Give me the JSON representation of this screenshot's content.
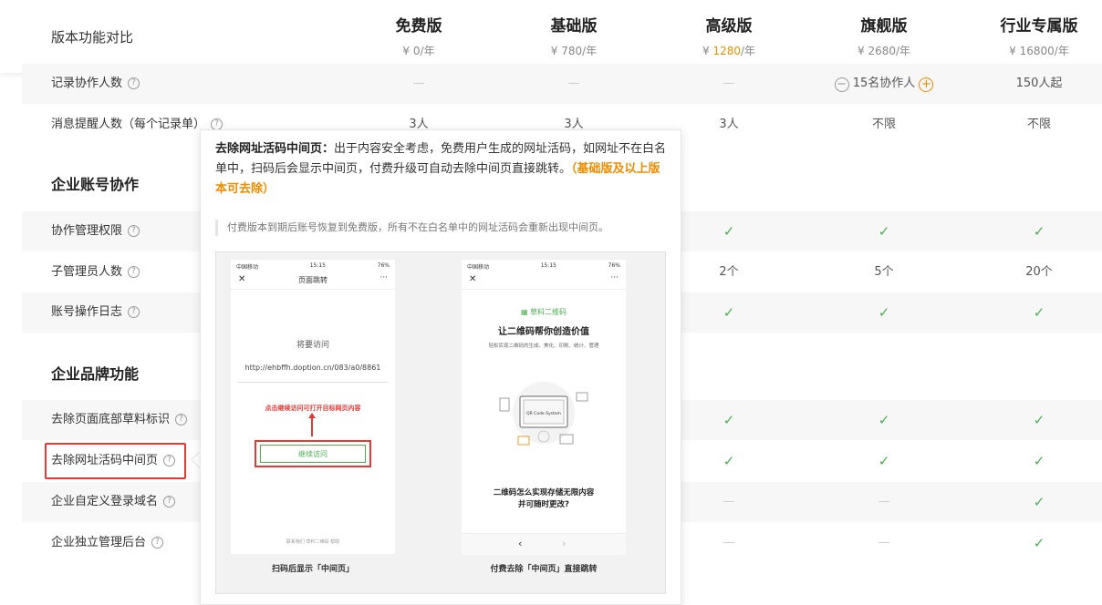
{
  "header": {
    "title": "版本功能对比",
    "currency": "¥",
    "per": "/年",
    "plans": [
      {
        "name": "免费版",
        "price": "0"
      },
      {
        "name": "基础版",
        "price": "780"
      },
      {
        "name": "高级版",
        "price": "1280"
      },
      {
        "name": "旗舰版",
        "price": "2680"
      },
      {
        "name": "行业专属版",
        "price": "16800"
      }
    ],
    "accent_color": "#f08c00"
  },
  "rows": {
    "collaborators": {
      "label": "记录协作人数",
      "cells": [
        "—",
        "—",
        "—",
        "15名协作人",
        "150人起"
      ]
    },
    "reminders": {
      "label": "消息提醒人数（每个记录单）",
      "cells": [
        "3人",
        "3人",
        "3人",
        "不限",
        "不限"
      ]
    }
  },
  "sections": {
    "account": {
      "title": "企业账号协作",
      "rows": [
        {
          "label": "协作管理权限",
          "cells": [
            "",
            "",
            "✓",
            "✓",
            "✓"
          ]
        },
        {
          "label": "子管理员人数",
          "cells": [
            "",
            "",
            "2个",
            "5个",
            "20个"
          ]
        },
        {
          "label": "账号操作日志",
          "cells": [
            "",
            "",
            "✓",
            "✓",
            "✓"
          ]
        }
      ]
    },
    "brand": {
      "title": "企业品牌功能",
      "rows": [
        {
          "label": "去除页面底部草料标识",
          "cells": [
            "",
            "",
            "✓",
            "✓",
            "✓"
          ]
        },
        {
          "label": "去除网址活码中间页",
          "cells": [
            "",
            "",
            "✓",
            "✓",
            "✓"
          ]
        },
        {
          "label": "企业自定义登录域名",
          "cells": [
            "",
            "",
            "—",
            "—",
            "✓"
          ]
        },
        {
          "label": "企业独立管理后台",
          "cells": [
            "",
            "",
            "—",
            "—",
            "✓"
          ]
        }
      ]
    }
  },
  "popover": {
    "title": "去除网址活码中间页：",
    "body": "出于内容安全考虑，免费用户生成的网址活码，如网址不在白名单中，扫码后会显示中间页，付费升级可自动去除中间页直接跳转。",
    "highlight": "（基础版及以上版本可去除）",
    "note": "付费版本到期后账号恢复到免费版，所有不在白名单中的网址活码会重新出现中间页。",
    "left_phone": {
      "status_left": "中国移动",
      "status_time": "15:15",
      "status_right": "76%",
      "nav_title": "页面跳转",
      "heading": "将要访问",
      "url": "http://ehbffh.doption.cn/083/a0/8861",
      "red_tip": "点击继续访问可打开目标网页内容",
      "button": "继续访问",
      "footer": "联系我们 草料二维码 帮助",
      "caption": "扫码后显示「中间页」"
    },
    "right_phone": {
      "status_left": "中国移动",
      "status_time": "15:15",
      "status_right": "76%",
      "brand": "草料二维码",
      "headline": "让二维码帮你创造价值",
      "subline": "轻松实现二维码的生成、美化、印刷、统计、管理",
      "illus_label": "QR Code System",
      "question_1": "二维码怎么实现存储无限内容",
      "question_2": "并可随时更改?",
      "caption": "付费去除「中间页」直接跳转"
    }
  }
}
